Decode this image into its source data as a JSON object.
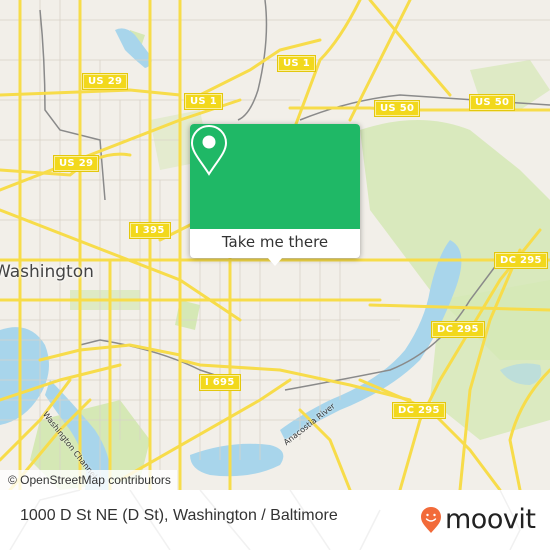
{
  "map": {
    "place_label": "Washington",
    "shields": [
      {
        "label": "US 29"
      },
      {
        "label": "US 1"
      },
      {
        "label": "US 29"
      },
      {
        "label": "I 395"
      },
      {
        "label": "US 1"
      },
      {
        "label": "US 50"
      },
      {
        "label": "US 50"
      },
      {
        "label": "DC 295"
      },
      {
        "label": "DC 295"
      },
      {
        "label": "DC 295"
      },
      {
        "label": "I 695"
      }
    ],
    "water_labels": [
      {
        "label": "Washington Channel"
      },
      {
        "label": "Anacostia River"
      }
    ],
    "attribution": "© OpenStreetMap contributors",
    "colors": {
      "land": "#f2efe9",
      "water": "#a8d5eb",
      "park": "#d5e8b5",
      "road": "#f7dc4a",
      "rail": "#888888"
    }
  },
  "popup": {
    "icon": "location-pin-icon",
    "action_label": "Take me there",
    "color": "#1fb866"
  },
  "footer": {
    "title": "1000 D St NE (D St), Washington / Baltimore",
    "logo_text": "moovit",
    "logo_color": "#f26b3a"
  }
}
